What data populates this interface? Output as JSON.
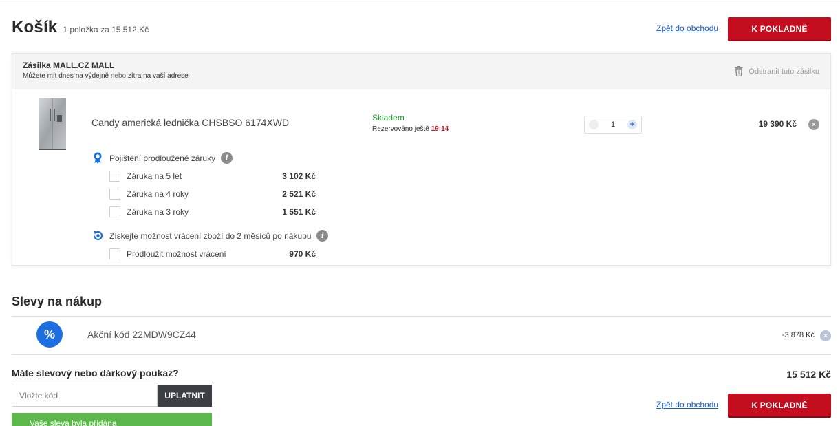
{
  "header": {
    "title": "Košík",
    "summary": "1 položka za 15 512 Kč",
    "back_link": "Zpět do obchodu",
    "checkout_label": "K POKLADNĚ"
  },
  "shipment": {
    "title": "Zásilka MALL.CZ MALL",
    "note_start": "Můžete mít dnes na výdejně",
    "note_mid": "nebo",
    "note_end": "zítra na vaší adrese",
    "remove_label": "Odstranit tuto zásilku"
  },
  "product": {
    "name": "Candy americká lednička CHSBSO 6174XWD",
    "stock": "Skladem",
    "reserved_text": "Rezervováno ještě",
    "reserved_time": "19:14",
    "quantity": "1",
    "price": "19 390 Kč",
    "remove_symbol": "×"
  },
  "warranty": {
    "title": "Pojištění prodloužené záruky",
    "info_symbol": "i",
    "options": [
      {
        "label": "Záruka na 5 let",
        "price": "3 102 Kč"
      },
      {
        "label": "Záruka na 4 roky",
        "price": "2 521 Kč"
      },
      {
        "label": "Záruka na 3 roky",
        "price": "1 551 Kč"
      }
    ]
  },
  "returns": {
    "title": "Získejte možnost vrácení zboží do 2 měsíců po nákupu",
    "info_symbol": "i",
    "option": {
      "label": "Prodloužit možnost vrácení",
      "price": "970 Kč"
    }
  },
  "discounts": {
    "title": "Slevy na nákup",
    "badge": "%",
    "code_label": "Akční kód 22MDW9CZ44",
    "amount": "-3 878 Kč",
    "remove_symbol": "×"
  },
  "voucher": {
    "question": "Máte slevový nebo dárkový poukaz?",
    "placeholder": "Vložte kód",
    "apply_label": "UPLATNIT",
    "success": "Vaše sleva byla přidána"
  },
  "footer": {
    "total": "15 512 Kč",
    "back_link": "Zpět do obchodu",
    "checkout_label": "K POKLADNĚ"
  },
  "colors": {
    "accent_red": "#c40d1f",
    "link_blue": "#1a5bd6",
    "stock_green": "#139b26",
    "success_green": "#5cb84a",
    "discount_blue": "#1b6fe0"
  },
  "icons": [
    "trash-icon",
    "award-ribbon-icon",
    "return-arrows-icon",
    "info-icon",
    "percent-icon",
    "close-icon",
    "plus-icon",
    "minus-icon"
  ]
}
